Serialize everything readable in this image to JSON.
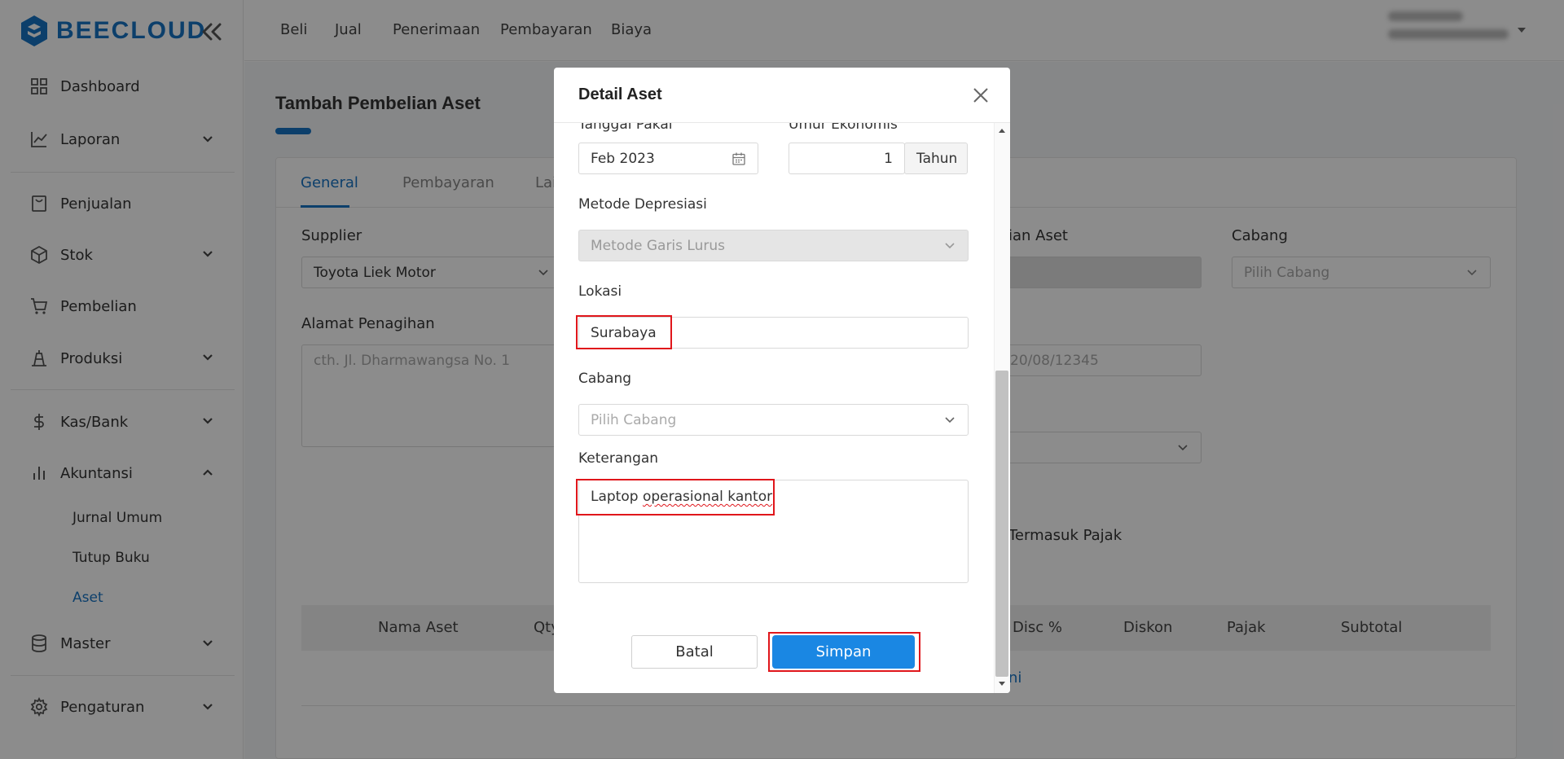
{
  "app": {
    "name": "BEECLOUD",
    "brand_color": "#1773c4"
  },
  "sidebar": {
    "items": [
      {
        "label": "Dashboard",
        "icon": "dashboard-icon"
      },
      {
        "label": "Laporan",
        "icon": "chart-line-icon"
      },
      {
        "label": "Penjualan",
        "icon": "sales-icon"
      },
      {
        "label": "Stok",
        "icon": "box-icon"
      },
      {
        "label": "Pembelian",
        "icon": "cart-icon"
      },
      {
        "label": "Produksi",
        "icon": "factory-icon"
      },
      {
        "label": "Kas/Bank",
        "icon": "dollar-icon"
      },
      {
        "label": "Akuntansi",
        "icon": "bar-chart-icon"
      },
      {
        "label": "Master",
        "icon": "database-icon"
      },
      {
        "label": "Pengaturan",
        "icon": "gear-icon"
      }
    ],
    "akuntansi_sub": [
      "Jurnal Umum",
      "Tutup Buku",
      "Aset"
    ]
  },
  "topbar": {
    "menu": [
      "Beli",
      "Jual",
      "Penerimaan",
      "Pembayaran",
      "Biaya"
    ]
  },
  "page": {
    "title": "Tambah Pembelian Aset",
    "tabs": [
      "General",
      "Pembayaran",
      "Lai"
    ],
    "supplier_label": "Supplier",
    "supplier_value": "Toyota Liek Motor",
    "alamat_label": "Alamat Penagihan",
    "alamat_placeholder": "cth. Jl. Dharmawangsa No. 1",
    "aset_label_partial": "ian Aset",
    "cabang_label": "Cabang",
    "cabang_placeholder": "Pilih Cabang",
    "nomor_placeholder_partial": "20/08/12345",
    "pajak_partial": "Termasuk Pajak",
    "link_partial": "ni",
    "table_headers": [
      "Nama Aset",
      "Qty",
      "Disc %",
      "Diskon",
      "Pajak",
      "Subtotal"
    ]
  },
  "modal": {
    "title": "Detail Aset",
    "tanggal_label": "Tanggal Pakai",
    "tanggal_value": "Feb 2023",
    "umur_label": "Umur Ekonomis",
    "umur_value": "1",
    "umur_unit": "Tahun",
    "metode_label": "Metode Depresiasi",
    "metode_value": "Metode Garis Lurus",
    "lokasi_label": "Lokasi",
    "lokasi_value": "Surabaya",
    "cabang_label": "Cabang",
    "cabang_placeholder": "Pilih Cabang",
    "keterangan_label": "Keterangan",
    "keterangan_value_1": "Laptop ",
    "keterangan_value_2": "operasional kantor",
    "cancel_label": "Batal",
    "save_label": "Simpan"
  }
}
